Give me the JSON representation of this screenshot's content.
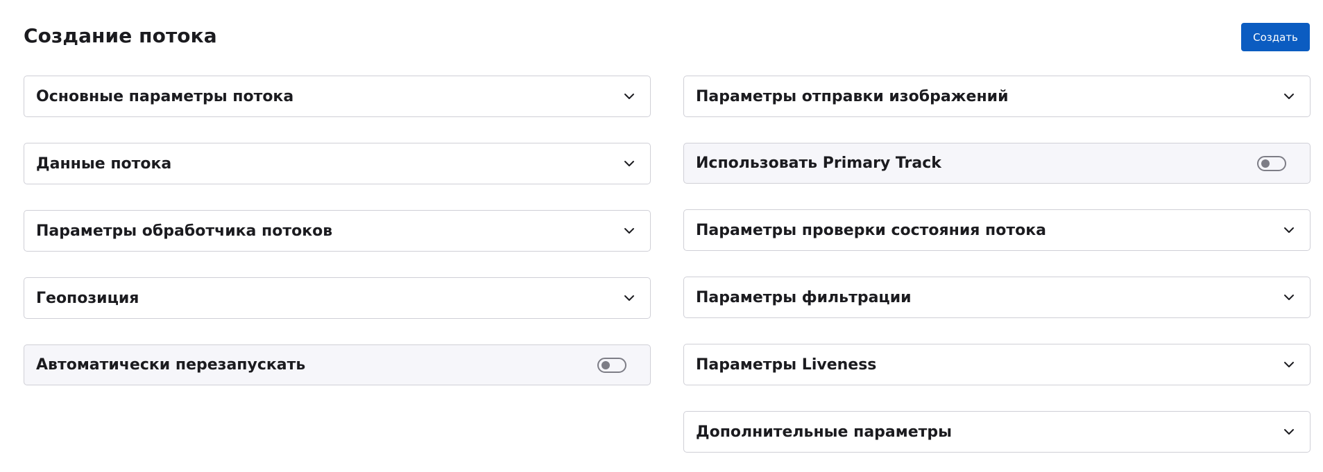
{
  "header": {
    "title": "Создание потока",
    "create_label": "Создать"
  },
  "left_sections": [
    {
      "label": "Основные параметры потока",
      "type": "accordion",
      "icon": "chevron-down-icon"
    },
    {
      "label": "Данные потока",
      "type": "accordion",
      "icon": "chevron-down-icon"
    },
    {
      "label": "Параметры обработчика потоков",
      "type": "accordion",
      "icon": "chevron-down-icon"
    },
    {
      "label": "Геопозиция",
      "type": "accordion",
      "icon": "chevron-down-icon"
    },
    {
      "label": "Автоматически перезапускать",
      "type": "toggle",
      "enabled": false
    }
  ],
  "right_sections": [
    {
      "label": "Параметры отправки изображений",
      "type": "accordion",
      "icon": "chevron-down-icon"
    },
    {
      "label": "Использовать Primary Track",
      "type": "toggle",
      "enabled": false
    },
    {
      "label": "Параметры проверки состояния потока",
      "type": "accordion",
      "icon": "chevron-down-icon"
    },
    {
      "label": "Параметры фильтрации",
      "type": "accordion",
      "icon": "chevron-down-icon"
    },
    {
      "label": "Параметры Liveness",
      "type": "accordion",
      "icon": "chevron-down-icon"
    },
    {
      "label": "Дополнительные параметры",
      "type": "accordion",
      "icon": "chevron-down-icon"
    }
  ],
  "colors": {
    "accent": "#0b5cc1",
    "border": "#cfcfd6",
    "toggle_panel_bg": "#f6f6fa",
    "switch_off": "#7d7d86"
  }
}
